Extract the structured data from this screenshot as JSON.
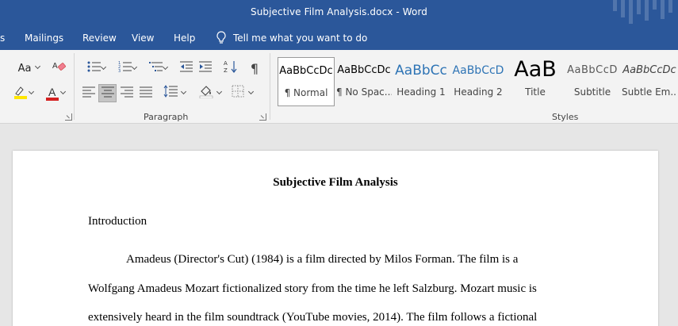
{
  "window": {
    "title": "Subjective Film Analysis.docx  -  Word"
  },
  "tabs": [
    "s",
    "Mailings",
    "Review",
    "View",
    "Help"
  ],
  "tell_me": {
    "placeholder": "Tell me what you want to do",
    "icon": "lightbulb-icon"
  },
  "ribbon": {
    "font_group": {
      "change_case_label": "Aa",
      "clear_formatting_icon": "eraser-icon",
      "highlight_color": "#ffe600",
      "font_color": "#d42020",
      "font_color_label": "A"
    },
    "paragraph_group": {
      "label": "Paragraph",
      "pilcrow": "¶"
    },
    "styles_group": {
      "label": "Styles",
      "items": [
        {
          "preview": "AaBbCcDc",
          "name": "¶ Normal"
        },
        {
          "preview": "AaBbCcDc",
          "name": "¶ No Spac..."
        },
        {
          "preview": "AaBbCc",
          "name": "Heading 1"
        },
        {
          "preview": "AaBbCcD",
          "name": "Heading 2"
        },
        {
          "preview": "AaB",
          "name": "Title"
        },
        {
          "preview": "AaBbCcD",
          "name": "Subtitle"
        },
        {
          "preview": "AaBbCcDc",
          "name": "Subtle Em..."
        }
      ]
    }
  },
  "document": {
    "title": "Subjective Film Analysis",
    "heading": "Introduction",
    "lines": [
      "Amadeus (Director's Cut) (1984) is a film directed by Milos Forman. The film is a",
      "Wolfgang Amadeus Mozart fictionalized story from the time he left Salzburg. Mozart music is",
      "extensively heard in the film soundtrack (YouTube movies, 2014). The film follows a fictional"
    ]
  },
  "colors": {
    "brand": "#2b579a",
    "ribbon": "#f3f3f3",
    "canvas": "#e6e6e6",
    "heading_style": "#2e74b5"
  }
}
